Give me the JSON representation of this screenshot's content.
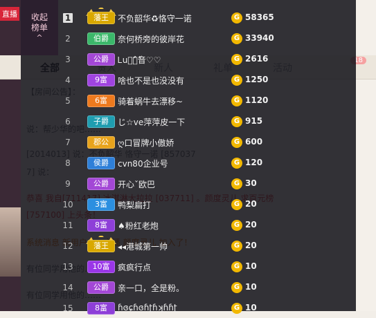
{
  "background": {
    "left_tag": "直播",
    "tabs": [
      {
        "label": "全部",
        "active": true
      },
      {
        "label": "贵人"
      },
      {
        "label": "新人"
      },
      {
        "label": "礼单"
      },
      {
        "label": "活动"
      }
    ],
    "tab_badge": "18",
    "lines": [
      {
        "text": "【房间公告】：",
        "cls": ""
      },
      {
        "text": "说：帮少华的吧……",
        "cls": ""
      },
      {
        "text": "[2014013] 说：不负韶华 恪守一诺 [857037",
        "cls": ""
      },
      {
        "text": "7] 说：",
        "cls": ""
      },
      {
        "text": "恭喜 我自[711417] 冰淇淋大拉拉 [037711] 。颜度灵儿 求百元榜",
        "cls": "red"
      },
      {
        "text": "[757100] 上头条！",
        "cls": "red"
      },
      {
        "text": "系统消息 新用户……主播 颜度灵儿 加入了！",
        "cls": "orange"
      },
      {
        "text": "有位同学用他的……",
        "cls": ""
      },
      {
        "text": "有位同学用他的……",
        "cls": ""
      }
    ]
  },
  "panel": {
    "collapse_label_1": "收起",
    "collapse_label_2": "榜单",
    "collapse_arrow": "^",
    "coin_symbol": "G",
    "rows": [
      {
        "rank": "1",
        "badge": "藩王",
        "color": "#d9a800",
        "name": "不负韶华♻恪守一诺",
        "score": "58365",
        "wings": true
      },
      {
        "rank": "2",
        "badge": "伯爵",
        "color": "#3bb86a",
        "name": "奈何桥旁的彼岸花",
        "score": "33940"
      },
      {
        "rank": "3",
        "badge": "公爵",
        "color": "#a347d6",
        "name": "Ꮮu梦ٌ之ٌ音♡♡",
        "score": "2616"
      },
      {
        "rank": "4",
        "badge": "9富",
        "color": "#a044e0",
        "name": "啥也不是也没没有",
        "score": "1250"
      },
      {
        "rank": "5",
        "badge": "6富",
        "color": "#ee7a1e",
        "name": "骑着蜗牛去漂移~",
        "score": "1120"
      },
      {
        "rank": "6",
        "badge": "子爵",
        "color": "#1f9db0",
        "name": "じ☆ve萍萍皮一下",
        "score": "915"
      },
      {
        "rank": "7",
        "badge": "郡公",
        "color": "#e8a31c",
        "name": "ღ口冒牌小傲娇",
        "score": "600"
      },
      {
        "rank": "8",
        "badge": "侯爵",
        "color": "#2e7fd8",
        "name": "cvn80企业号",
        "score": "120"
      },
      {
        "rank": "9",
        "badge": "公爵",
        "color": "#a347d6",
        "name": "开心ˇ欧巴",
        "score": "30"
      },
      {
        "rank": "10",
        "badge": "3富",
        "color": "#2b8fe0",
        "name": "鸭梨扁打",
        "score": "20"
      },
      {
        "rank": "11",
        "badge": "8富",
        "color": "#8e3fd8",
        "name": "♠粉红老炮",
        "score": "20"
      },
      {
        "rank": "12",
        "badge": "藩王",
        "color": "#d9a800",
        "name": "◂◂港城第一帅",
        "score": "20",
        "wings": true
      },
      {
        "rank": "13",
        "badge": "10富",
        "color": "#9a36e8",
        "name": "疯疯行点",
        "score": "10"
      },
      {
        "rank": "14",
        "badge": "公爵",
        "color": "#a347d6",
        "name": "亲一口，全是粉。",
        "score": "10"
      },
      {
        "rank": "15",
        "badge": "8富",
        "color": "#8e3fd8",
        "name": "ɦɞɕɦɞɦʈɦʞɦɦʈ",
        "score": "10"
      }
    ]
  }
}
